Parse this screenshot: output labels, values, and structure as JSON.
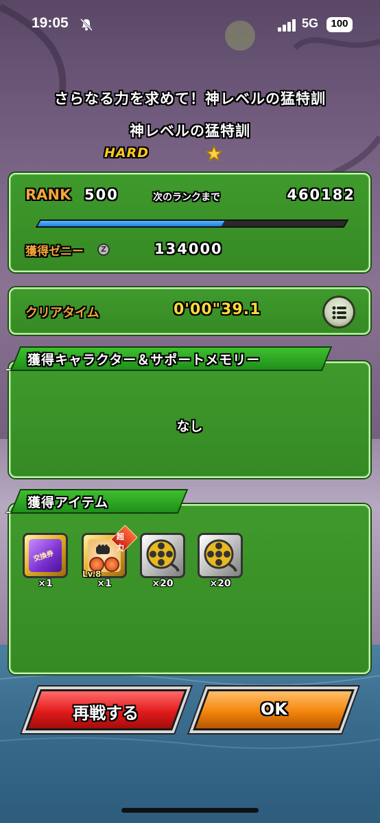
{
  "status_bar": {
    "time": "19:05",
    "network": "5G",
    "battery": "100",
    "icons": [
      "bell-slash-icon",
      "signal-icon",
      "battery-icon"
    ]
  },
  "quest": {
    "title": "さらなる力を求めて！神レベルの猛特訓",
    "stage": "神レベルの猛特訓",
    "difficulty": "HARD"
  },
  "rank_panel": {
    "rank_label": "RANK",
    "rank_value": "500",
    "next_rank_label": "次のランクまで",
    "next_rank_value": "460182",
    "exp_progress_fraction": 0.6,
    "zeni_label": "獲得ゼニー",
    "zeni_icon": "Z",
    "zeni_value": "134000"
  },
  "time_panel": {
    "clear_time_label": "クリアタイム",
    "clear_time_value": "0'00\"39.1"
  },
  "character_section": {
    "title": "獲得キャラクター＆サポートメモリー",
    "empty_text": "なし"
  },
  "item_section": {
    "title": "獲得アイテム",
    "items": [
      {
        "icon": "exchange-ticket-icon",
        "icon_text": "交換券",
        "count": "×1"
      },
      {
        "icon": "training-medal-icon",
        "badge": "超力",
        "level": "Lv.8",
        "count": "×1"
      },
      {
        "icon": "film-reel-icon",
        "count": "×20"
      },
      {
        "icon": "film-reel-icon",
        "count": "×20"
      }
    ]
  },
  "buttons": {
    "retry_label": "再戦する",
    "ok_label": "OK"
  },
  "colors": {
    "panel_green": "#3f9a2c",
    "label_orange": "#f4a53a",
    "time_yellow": "#ffd93a",
    "retry_red": "#e21b1b",
    "ok_orange": "#f3860c",
    "exp_blue": "#1e7ee0"
  }
}
